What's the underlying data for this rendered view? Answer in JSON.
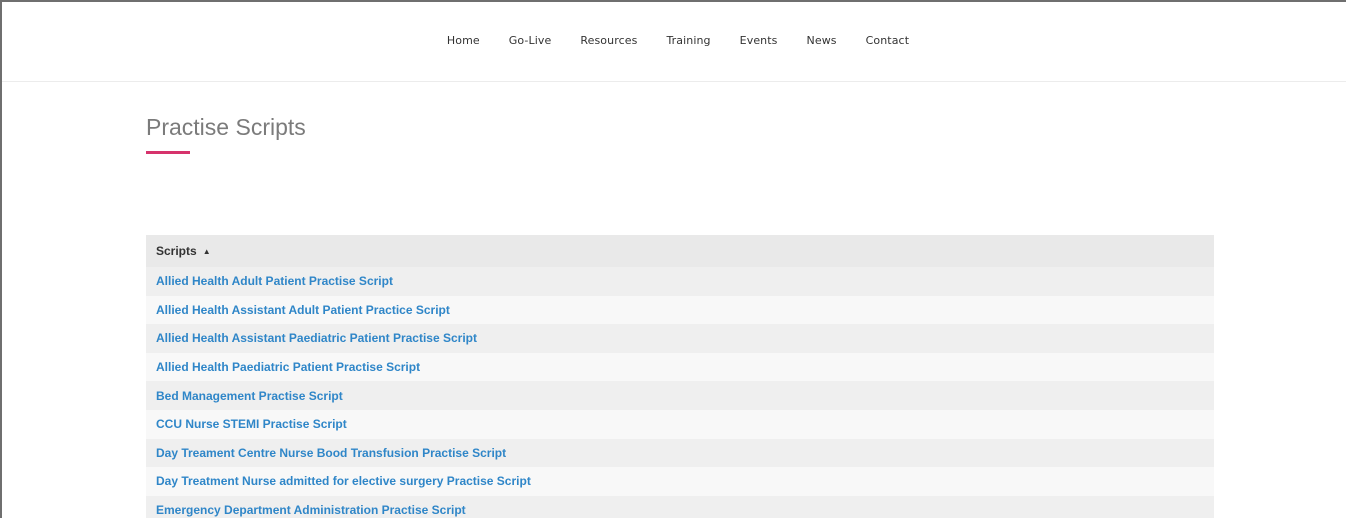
{
  "nav": {
    "items": [
      {
        "label": "Home"
      },
      {
        "label": "Go-Live"
      },
      {
        "label": "Resources"
      },
      {
        "label": "Training"
      },
      {
        "label": "Events"
      },
      {
        "label": "News"
      },
      {
        "label": "Contact"
      }
    ]
  },
  "page": {
    "title": "Practise Scripts",
    "accent_color": "#d6336c"
  },
  "table": {
    "header": "Scripts",
    "sort_icon": "sort-ascending-icon",
    "rows": [
      {
        "label": "Allied Health Adult Patient Practise Script"
      },
      {
        "label": "Allied Health Assistant Adult Patient Practice Script"
      },
      {
        "label": "Allied Health Assistant Paediatric Patient Practise Script"
      },
      {
        "label": "Allied Health Paediatric Patient Practise Script"
      },
      {
        "label": "Bed Management Practise Script"
      },
      {
        "label": "CCU Nurse STEMI Practise Script"
      },
      {
        "label": "Day Treament Centre Nurse Bood Transfusion Practise Script"
      },
      {
        "label": "Day Treatment Nurse admitted for elective surgery Practise Script"
      },
      {
        "label": "Emergency Department Administration Practise Script"
      }
    ],
    "link_color": "#2f86c8"
  }
}
